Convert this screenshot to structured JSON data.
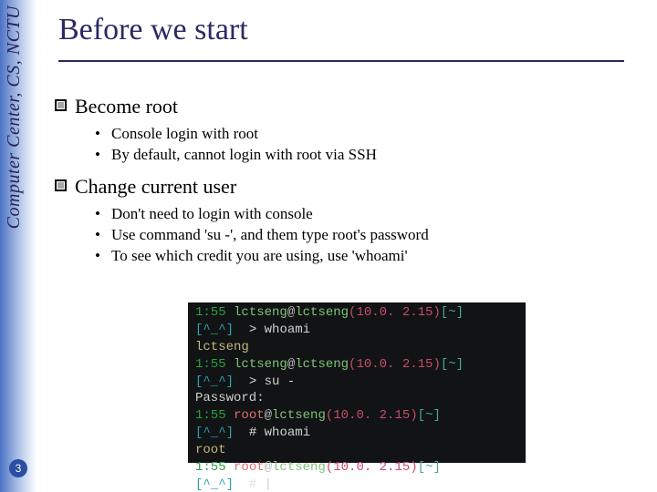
{
  "sidebar": {
    "org_text": "Computer Center, CS, NCTU"
  },
  "page": {
    "number": "3"
  },
  "title": "Before we start",
  "sections": [
    {
      "heading": "Become root",
      "items": [
        "Console login with root",
        "By default, cannot login with root via SSH"
      ]
    },
    {
      "heading": "Change current user",
      "items": [
        "Don't need to login with console",
        "Use command 'su -', and them type root's password",
        "To see which credit you are using, use 'whoami'"
      ]
    }
  ],
  "terminal": {
    "time": "1:55",
    "user": "lctseng",
    "host": "lctseng",
    "ip": "(10.0. 2.15)",
    "path": "[~]",
    "face_user": "[^_^]",
    "prompt_user": ">",
    "prompt_root": "#",
    "root_user": "root",
    "cmd_whoami": "whoami",
    "out_whoami_user": "lctseng",
    "cmd_su": "su -",
    "password_label": "Password:",
    "out_whoami_root": "root",
    "cursor": "|"
  }
}
